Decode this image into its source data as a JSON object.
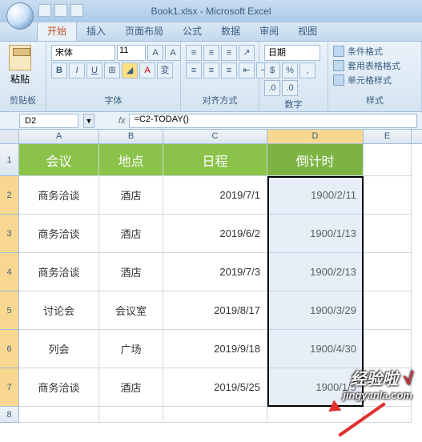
{
  "title": "Book1.xlsx - Microsoft Excel",
  "tabs": [
    "开始",
    "插入",
    "页面布局",
    "公式",
    "数据",
    "审阅",
    "视图"
  ],
  "ribbon": {
    "paste_label": "粘贴",
    "clipboard_group": "剪贴板",
    "font_name": "宋体",
    "font_size": "11",
    "font_group": "字体",
    "align_group": "对齐方式",
    "number_format": "日期",
    "number_group": "数字",
    "style_cond": "条件格式",
    "style_table": "套用表格格式",
    "style_cell": "单元格样式",
    "style_group": "样式"
  },
  "name_box": "D2",
  "formula": "=C2-TODAY()",
  "columns": [
    "A",
    "B",
    "C",
    "D",
    "E"
  ],
  "rows": [
    "1",
    "2",
    "3",
    "4",
    "5",
    "6",
    "7",
    "8"
  ],
  "headers": {
    "a": "会议",
    "b": "地点",
    "c": "日程",
    "d": "倒计时"
  },
  "data": [
    {
      "a": "商务洽谈",
      "b": "酒店",
      "c": "2019/7/1",
      "d": "1900/2/11"
    },
    {
      "a": "商务洽谈",
      "b": "酒店",
      "c": "2019/6/2",
      "d": "1900/1/13"
    },
    {
      "a": "商务洽谈",
      "b": "酒店",
      "c": "2019/7/3",
      "d": "1900/2/13"
    },
    {
      "a": "讨论会",
      "b": "会议室",
      "c": "2019/8/17",
      "d": "1900/3/29"
    },
    {
      "a": "列会",
      "b": "广场",
      "c": "2019/9/18",
      "d": "1900/4/30"
    },
    {
      "a": "商务洽谈",
      "b": "酒店",
      "c": "2019/5/25",
      "d": "1900/1/5"
    }
  ],
  "watermark": {
    "main": "经验啦",
    "sub": "jingyanla.com"
  }
}
